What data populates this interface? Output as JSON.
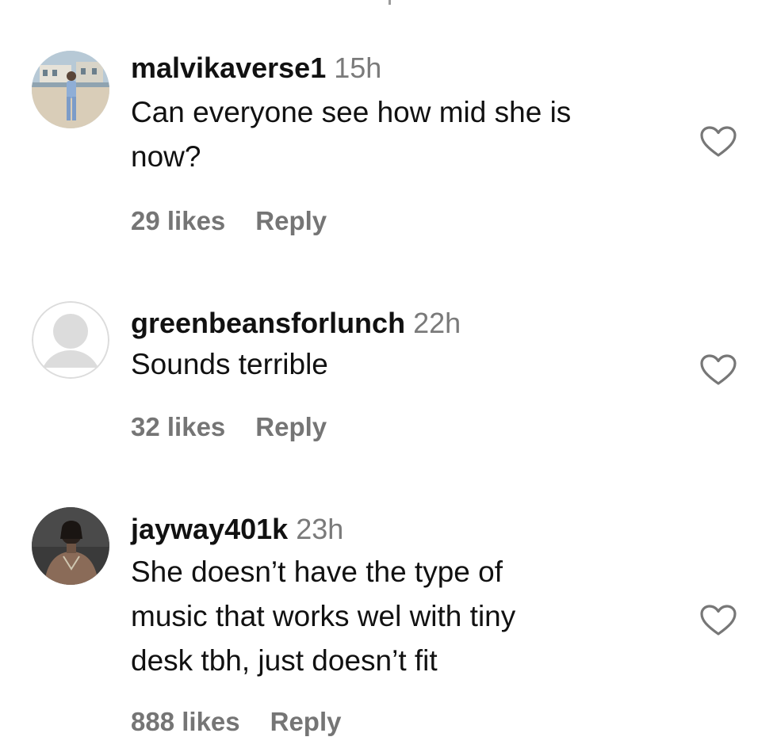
{
  "comments": [
    {
      "username": "malvikaverse1",
      "time": "15h",
      "text_lines": [
        "Can everyone see how mid she is",
        "now?"
      ],
      "likes": "29 likes",
      "reply": "Reply",
      "avatar_icon": "photo-avatar-beach",
      "like_icon": "heart-outline-icon"
    },
    {
      "username": "greenbeansforlunch",
      "time": "22h",
      "text_lines": [
        "Sounds terrible"
      ],
      "likes": "32 likes",
      "reply": "Reply",
      "avatar_icon": "default-avatar",
      "like_icon": "heart-outline-icon"
    },
    {
      "username": "jayway401k",
      "time": "23h",
      "text_lines": [
        "She doesn’t have the type of",
        "music that works wel with tiny",
        "desk tbh, just doesn’t fit"
      ],
      "likes": "888 likes",
      "reply": "Reply",
      "avatar_icon": "photo-avatar-dark",
      "like_icon": "heart-outline-icon"
    }
  ],
  "colors": {
    "username": "#111111",
    "meta_gray": "#757575",
    "time_gray": "#7a7a7a",
    "background": "#ffffff"
  }
}
